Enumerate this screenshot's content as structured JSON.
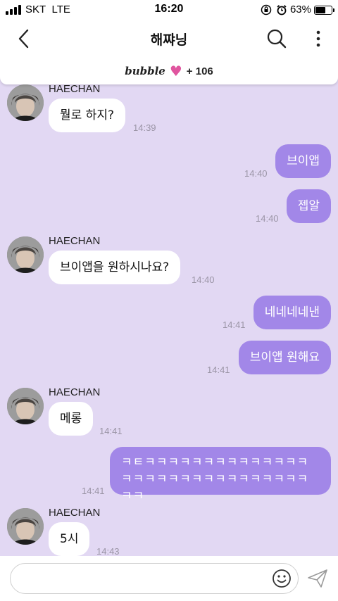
{
  "status_bar": {
    "carrier": "SKT",
    "network": "LTE",
    "time": "16:20",
    "battery_percent": "63%",
    "battery_level": 0.63,
    "icons": [
      "rotation-lock-icon",
      "alarm-icon"
    ]
  },
  "header": {
    "title": "해쨔닝",
    "back_icon": "chevron-left-icon",
    "search_icon": "search-icon",
    "more_icon": "more-vertical-icon"
  },
  "banner": {
    "logo": "bubble",
    "count": "+ 106",
    "heart_color": "#e0559f"
  },
  "messages": [
    {
      "direction": "in",
      "sender": "HAECHAN",
      "text": "뭘로 하지?",
      "time": "14:39"
    },
    {
      "direction": "out",
      "text": "브이앱",
      "time": "14:40"
    },
    {
      "direction": "out",
      "text": "젭알",
      "time": "14:40"
    },
    {
      "direction": "in",
      "sender": "HAECHAN",
      "text": "브이앱을 원하시나요?",
      "time": "14:40"
    },
    {
      "direction": "out",
      "text": "네네네네낸",
      "time": "14:41"
    },
    {
      "direction": "out",
      "text": "브이앱 원해요",
      "time": "14:41"
    },
    {
      "direction": "in",
      "sender": "HAECHAN",
      "text": "메롱",
      "time": "14:41"
    },
    {
      "direction": "out",
      "text": "ㅋㅌㅋㅋㅋㅋㅋㅋㅋㅋㅋㅋㅋㅋㅋㅋㅋㅋㅋㅋㅋㅋㅋㅋㅋㅋㅋㅋㅋㅋㅋㅋㅋㅋ",
      "time": "14:41"
    },
    {
      "direction": "in",
      "sender": "HAECHAN",
      "text": "5시",
      "time": "14:43"
    }
  ],
  "input": {
    "placeholder": "",
    "emoji_icon": "smiley-icon",
    "send_icon": "send-icon"
  },
  "colors": {
    "chat_background": "#e2d8f3",
    "outgoing_bubble": "#a287e8",
    "incoming_bubble": "#ffffff"
  }
}
